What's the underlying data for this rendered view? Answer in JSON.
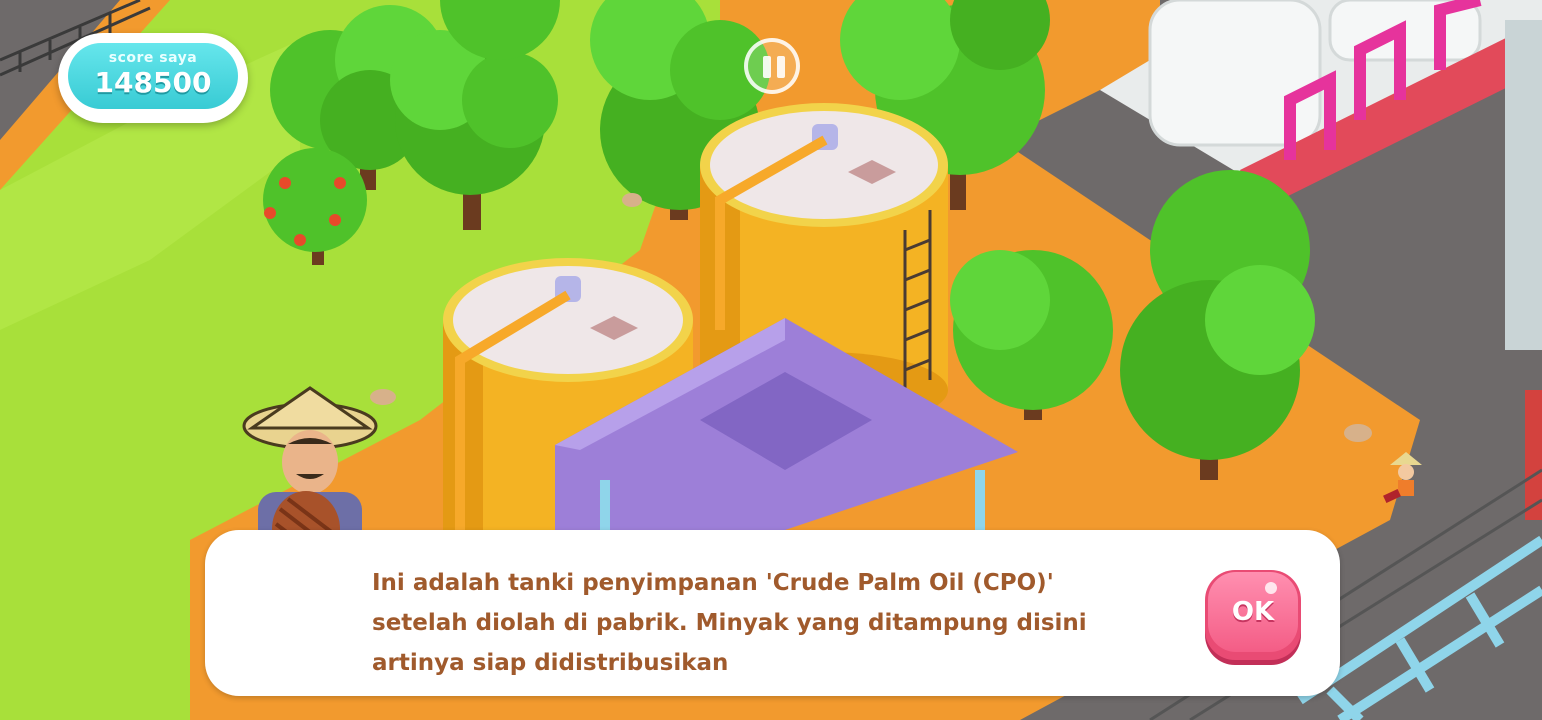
{
  "hud": {
    "score_label": "score saya",
    "score_value": "148500"
  },
  "dialog": {
    "lines": [
      "Ini adalah tanki penyimpanan 'Crude Palm Oil (CPO)'",
      "setelah diolah di pabrik. Minyak yang ditampung disini",
      "artinya siap didistribusikan"
    ],
    "ok_label": "OK"
  },
  "icons": {
    "pause": "pause-icon"
  },
  "colors": {
    "score_badge": "#38cbd4",
    "dialog_text": "#a05a2c",
    "ok_button": "#f45d86",
    "grass": "#a8e03a",
    "path": "#f29a2e",
    "tank": "#f4b323",
    "roof": "#9d7fd8"
  }
}
